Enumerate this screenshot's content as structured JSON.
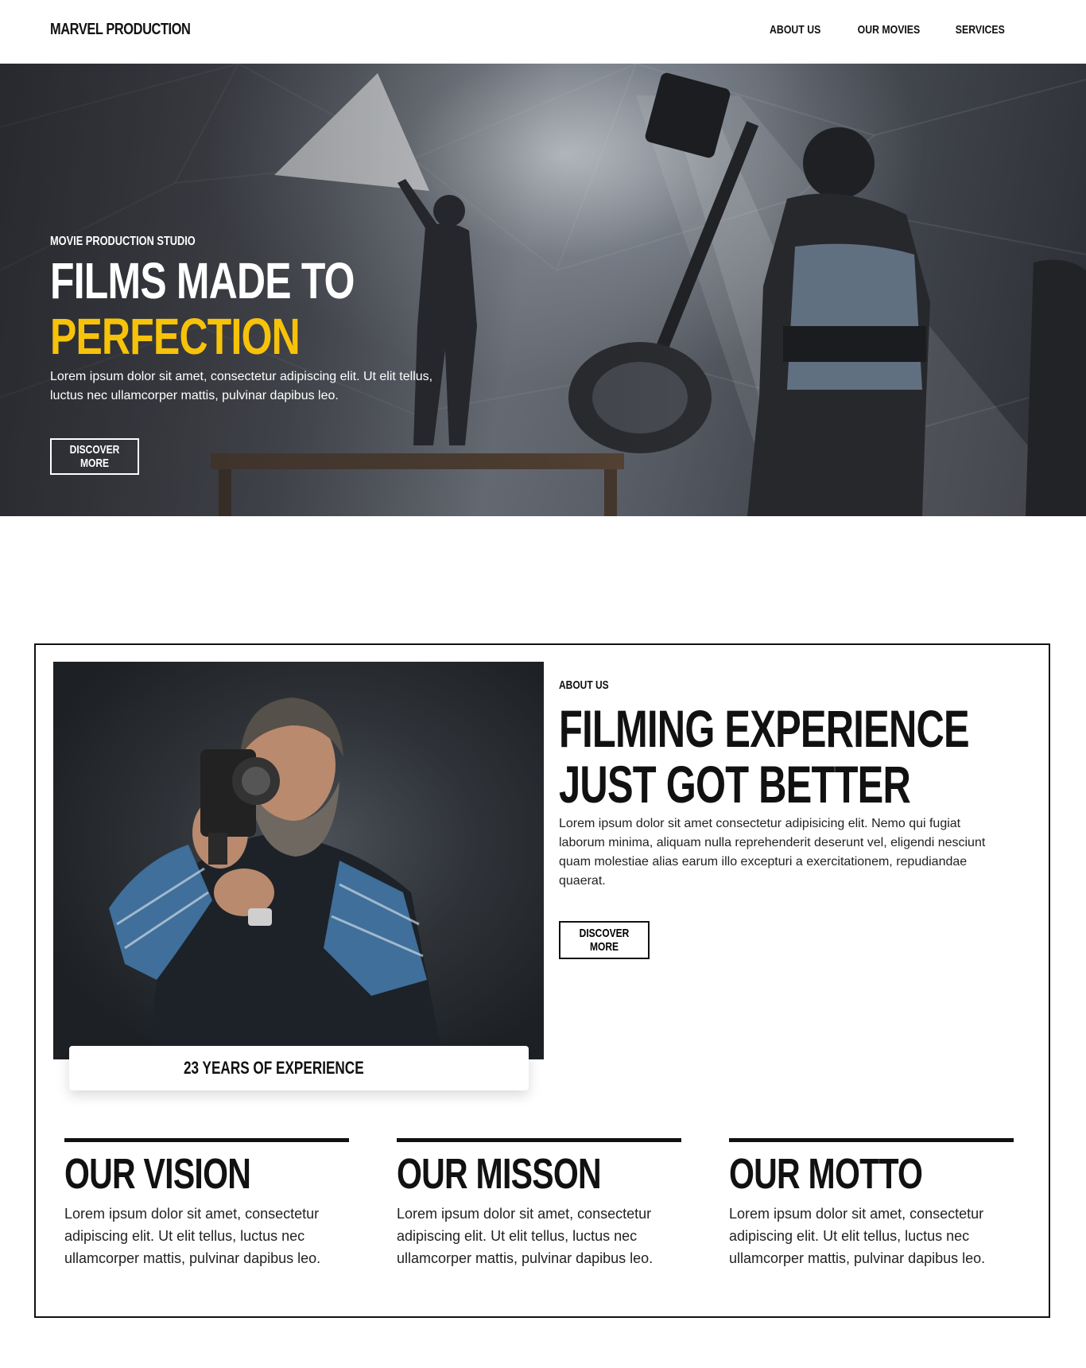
{
  "nav": {
    "brand": "MARVEL PRODUCTION",
    "links": [
      "ABOUT US",
      "OUR MOVIES",
      "SERVICES"
    ]
  },
  "hero": {
    "eyebrow": "MOVIE PRODUCTION STUDIO",
    "title_line1": "FILMS MADE TO",
    "title_line2": "PERFECTION",
    "text": "Lorem ipsum dolor sit amet, consectetur adipiscing elit. Ut elit tellus, luctus nec ullamcorper mattis, pulvinar dapibus leo.",
    "button": "DISCOVER MORE"
  },
  "about": {
    "badge": "23 YEARS OF EXPERIENCE",
    "eyebrow": "ABOUT US",
    "title_line1": "FILMING EXPERIENCE",
    "title_line2": "JUST GOT BETTER",
    "text": "Lorem ipsum dolor sit amet consectetur adipisicing elit. Nemo qui fugiat laborum minima, aliquam nulla reprehenderit deserunt vel, eligendi nesciunt quam molestiae alias earum illo excepturi a exercitationem, repudiandae quaerat.",
    "button": "DISCOVER MORE",
    "columns": [
      {
        "title": "OUR VISION",
        "text": "Lorem ipsum dolor sit amet, consectetur adipiscing elit. Ut elit tellus, luctus nec ullamcorper mattis, pulvinar dapibus leo."
      },
      {
        "title": "OUR MISSON",
        "text": "Lorem ipsum dolor sit amet, consectetur adipiscing elit. Ut elit tellus, luctus nec ullamcorper mattis, pulvinar dapibus leo."
      },
      {
        "title": "OUR MOTTO",
        "text": "Lorem ipsum dolor sit amet, consectetur adipiscing elit. Ut elit tellus, luctus nec ullamcorper mattis, pulvinar dapibus leo."
      }
    ]
  },
  "colors": {
    "accent": "#f7c20a",
    "text": "#111111",
    "background": "#ffffff"
  }
}
